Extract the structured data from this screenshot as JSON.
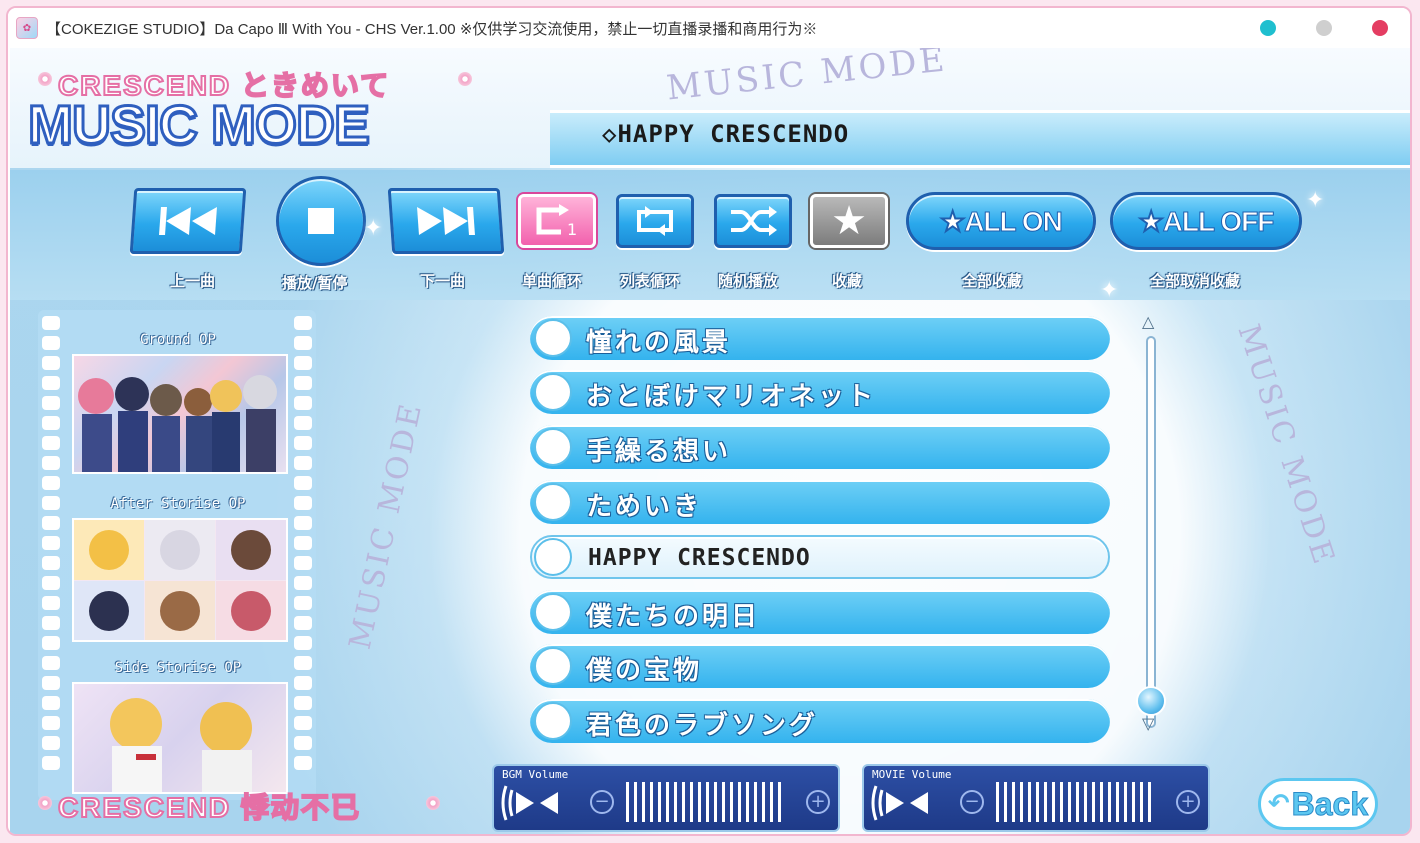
{
  "window": {
    "title": "【COKEZIGE STUDIO】Da Capo Ⅲ With You - CHS Ver.1.00 ※仅供学习交流使用，禁止一切直播录播和商用行为※",
    "controls": {
      "dot1_color": "#1fbfcf",
      "dot2_color": "#cfcfcf",
      "dot3_color": "#e43d62"
    }
  },
  "header": {
    "subtitle_top": "CRESCEND ときめいて",
    "title": "MUSIC MODE",
    "subtitle_bottom": "CRESCEND 悸动不已",
    "deco_text": "MUSIC MODE"
  },
  "now_playing": "◇HAPPY CRESCENDO",
  "controls": {
    "prev_label": "上一曲",
    "play_label": "播放/暂停",
    "next_label": "下一曲",
    "single_loop_label": "单曲循环",
    "list_loop_label": "列表循环",
    "shuffle_label": "随机播放",
    "favorite_label": "收藏",
    "all_on_text": "★ALL ON",
    "all_on_label": "全部收藏",
    "all_off_text": "★ALL OFF",
    "all_off_label": "全部取消收藏"
  },
  "film": {
    "items": [
      {
        "label": "Ground OP"
      },
      {
        "label": "After Storise OP"
      },
      {
        "label": "Side Storise OP"
      }
    ]
  },
  "tracks": [
    {
      "title": "憧れの風景"
    },
    {
      "title": "おとぼけマリオネット"
    },
    {
      "title": "手繰る想い"
    },
    {
      "title": "ためいき"
    },
    {
      "title": "HAPPY CRESCENDO",
      "selected": true
    },
    {
      "title": "僕たちの明日"
    },
    {
      "title": "僕の宝物"
    },
    {
      "title": "君色のラブソング"
    }
  ],
  "volume": {
    "bgm_label": "BGM Volume",
    "movie_label": "MOVIE Volume"
  },
  "back_label": "Back"
}
